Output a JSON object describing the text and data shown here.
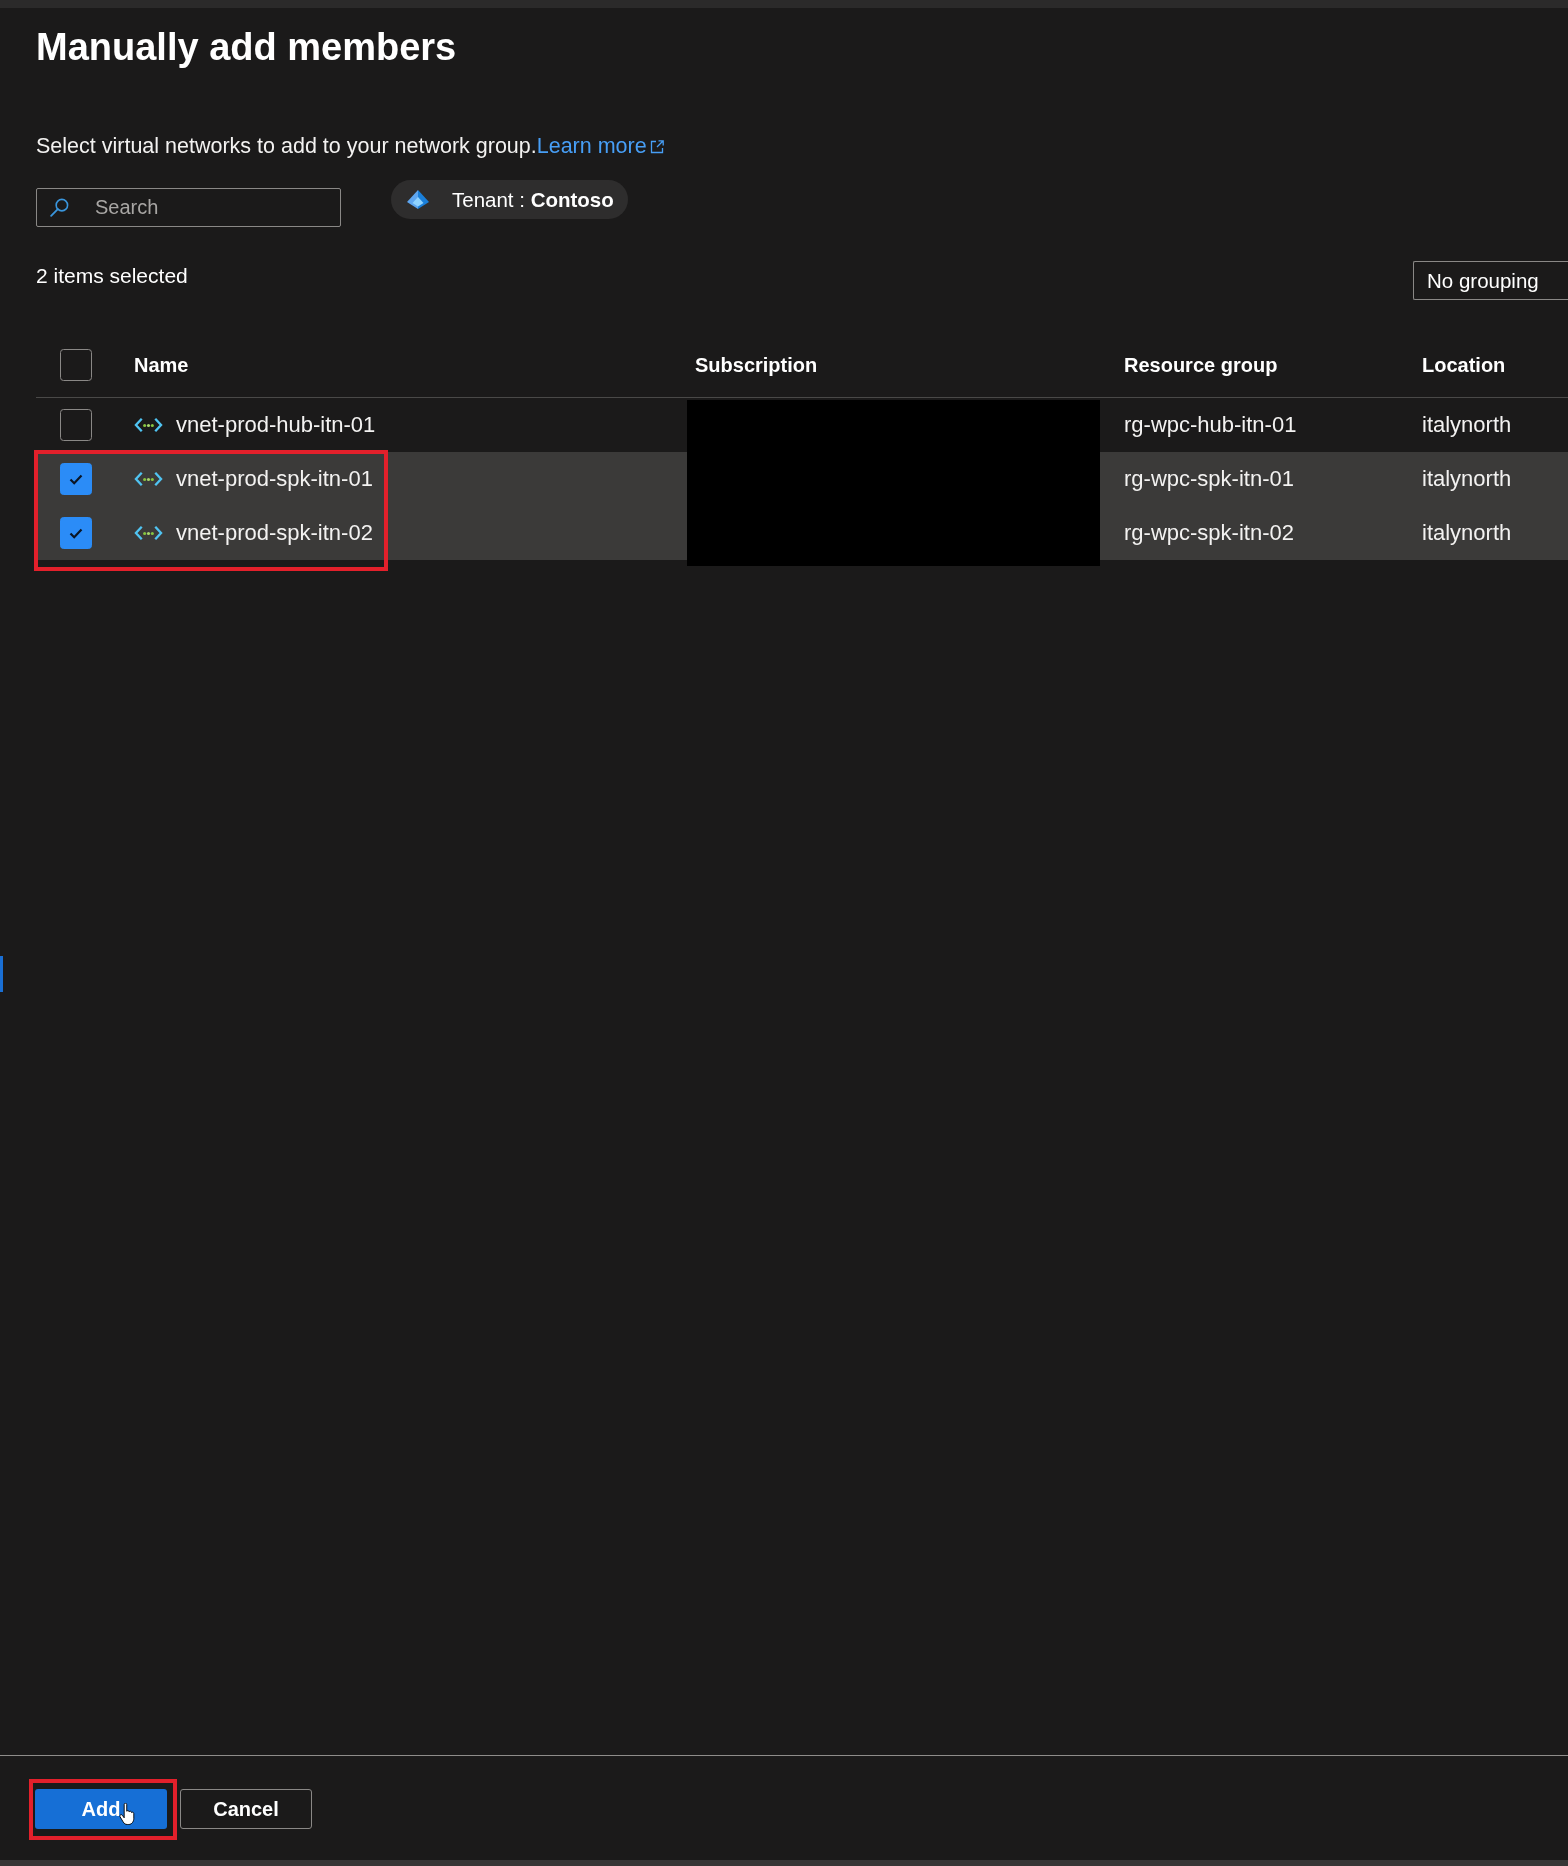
{
  "panel": {
    "title": "Manually add members",
    "description": {
      "text": "Select virtual networks to add to your network group.",
      "link": "Learn more"
    },
    "search": {
      "placeholder": "Search"
    },
    "tenant_filter": {
      "label": "Tenant : **Contoso**"
    },
    "selection_summary": "2 items selected",
    "grouping": {
      "value": "No grouping"
    },
    "table": {
      "select_all": {
        "checked": false
      },
      "columns": [
        {
          "label": "Name",
          "redacted": false
        },
        {
          "label": "Subscription",
          "redacted": true
        },
        {
          "label": "Resource group",
          "redacted": false
        },
        {
          "label": "Location",
          "redacted": false
        }
      ],
      "rows": [
        {
          "name": "vnet-prod-hub-itn-01",
          "resource_group": "rg-wpc-hub-itn-01",
          "location": "italynorth",
          "selected": false,
          "highlighted": false
        },
        {
          "name": "vnet-prod-spk-itn-01",
          "resource_group": "rg-wpc-spk-itn-01",
          "location": "italynorth",
          "selected": true,
          "highlighted": true
        },
        {
          "name": "vnet-prod-spk-itn-02",
          "resource_group": "rg-wpc-spk-itn-02",
          "location": "italynorth",
          "selected": true,
          "highlighted": true
        }
      ]
    },
    "buttons": [
      {
        "label": "Add",
        "kind": "primary",
        "highlighted": true,
        "hovered": true
      },
      {
        "label": "Cancel",
        "kind": "secondary",
        "highlighted": false,
        "hovered": false
      }
    ]
  }
}
